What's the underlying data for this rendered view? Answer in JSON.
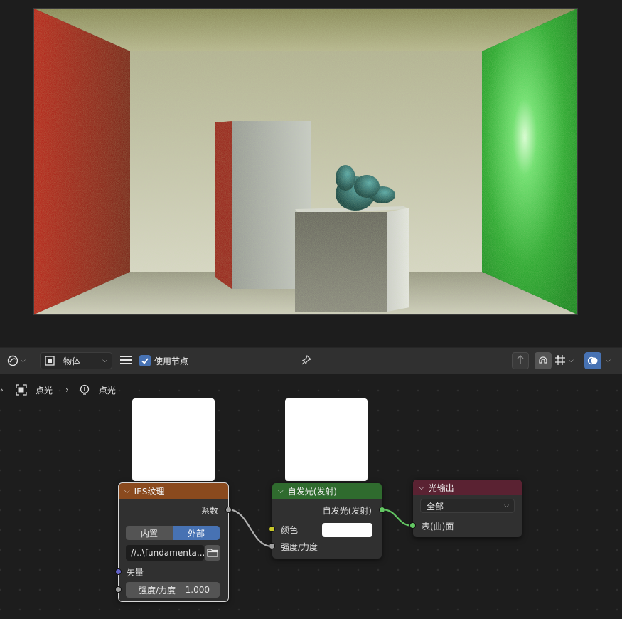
{
  "toolbar": {
    "editor_type_icon": "shader-editor-icon",
    "object_mode_label": "物体",
    "use_nodes_label": "使用节点",
    "use_nodes_checked": true
  },
  "breadcrumb": {
    "object_name": "点光",
    "light_name": "点光"
  },
  "nodes": {
    "ies": {
      "title": "IES纹理",
      "header_color": "#8a4a1e",
      "output_factor": "系数",
      "mode_internal": "内置",
      "mode_external": "外部",
      "filepath": "//..\\fundamenta...",
      "input_vector": "矢量",
      "strength_label": "强度/力度",
      "strength_value": "1.000"
    },
    "emission": {
      "title": "自发光(发射)",
      "header_color": "#2f6b2e",
      "output_emission": "自发光(发射)",
      "input_color": "颜色",
      "color_value": "#ffffff",
      "input_strength": "强度/力度"
    },
    "light_output": {
      "title": "光输出",
      "header_color": "#5a2232",
      "target_value": "全部",
      "input_surface": "表(曲)面"
    }
  }
}
